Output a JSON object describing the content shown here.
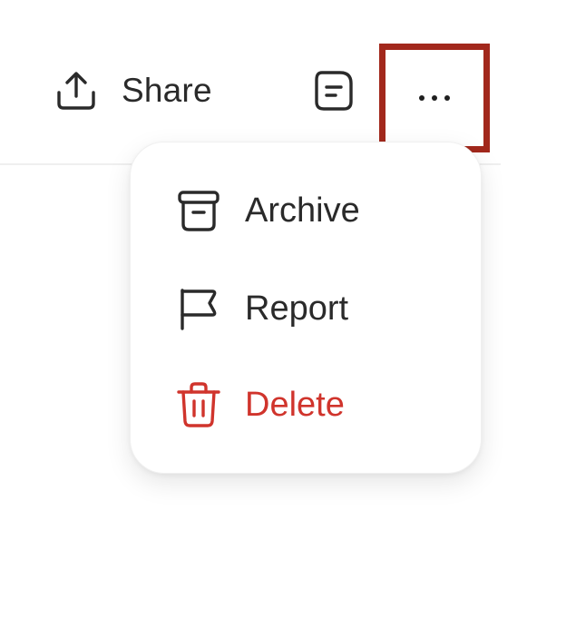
{
  "toolbar": {
    "share_label": "Share",
    "share_icon": "upload-icon",
    "notes_icon": "note-icon",
    "more_icon": "more-horizontal-icon",
    "highlight_color": "#a2281c"
  },
  "menu": {
    "items": [
      {
        "label": "Archive",
        "icon": "archive-icon",
        "color": "#2a2a2a"
      },
      {
        "label": "Report",
        "icon": "flag-icon",
        "color": "#2a2a2a"
      },
      {
        "label": "Delete",
        "icon": "trash-icon",
        "color": "#d0342c"
      }
    ]
  }
}
